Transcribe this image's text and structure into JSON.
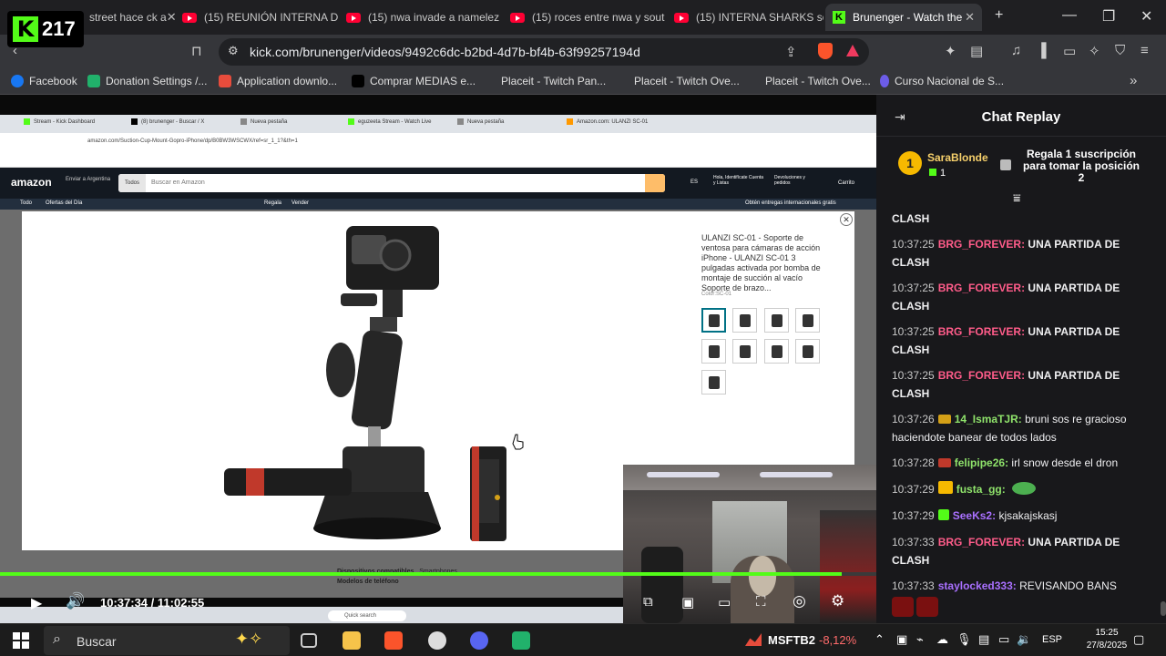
{
  "overlay": {
    "badge_count": "217"
  },
  "browser": {
    "tabs": [
      {
        "label": "street hace ck a",
        "icon": "partial-icon"
      },
      {
        "label": "(15) REUNIÓN INTERNA DI",
        "icon": "youtube-icon"
      },
      {
        "label": "(15) nwa invade a namelez",
        "icon": "youtube-icon"
      },
      {
        "label": "(15) roces entre nwa y sout",
        "icon": "youtube-icon"
      },
      {
        "label": "(15) INTERNA SHARKS sob",
        "icon": "youtube-icon"
      },
      {
        "label": "Brunenger - Watch the",
        "icon": "kick-icon",
        "active": true
      }
    ],
    "url": "kick.com/brunenger/videos/9492c6dc-b2bd-4d7b-bf4b-63f99257194d",
    "bookmarks": [
      {
        "label": "Facebook",
        "color": "#1877f2"
      },
      {
        "label": "Donation Settings /...",
        "color": "#21b16b"
      },
      {
        "label": "Application downlo...",
        "color": "#e74c3c"
      },
      {
        "label": "Comprar MEDIAS e...",
        "color": "#111111"
      },
      {
        "label": "Placeit - Twitch Pan...",
        "color": "#35363a"
      },
      {
        "label": "Placeit - Twitch Ove...",
        "color": "#35363a"
      },
      {
        "label": "Placeit - Twitch Ove...",
        "color": "#35363a"
      },
      {
        "label": "Curso Nacional de S...",
        "color": "#6c5ce7"
      }
    ]
  },
  "video": {
    "inner_tabs": [
      "Stream - Kick Dashboard",
      "(8) brunenger - Buscar / X",
      "Nueva pestaña",
      "eguzeeta Stream - Watch Live",
      "Nueva pestaña",
      "Amazon.com: ULANZI SC-01"
    ],
    "inner_url": "amazon.com/Suction-Cup-Mount-Gopro-iPhone/dp/B0BW3WSCWX/ref=sr_1_1?&th=1",
    "amazon": {
      "logo": "amazon",
      "deliver": "Enviar a Argentina",
      "search_category": "Todos",
      "search_placeholder": "Buscar en Amazon",
      "lang": "ES",
      "account": "Hola, Identifícate Cuenta y Listas",
      "orders": "Devoluciones y pedidos",
      "cart": "Carrito",
      "sub_nav": [
        "Todo",
        "Ofertas del Día",
        "Regala",
        "Vender"
      ],
      "ship_note": "Obtén entregas internacionales gratis",
      "product_title": "ULANZI SC-01 - Soporte de ventosa para cámaras de acción iPhone - ULANZI SC-01 3 pulgadas activada por bomba de montaje de succión al vacío Soporte de brazo...",
      "color_label": "Color:SC-01",
      "below": [
        "Dispositivos compatibles",
        "Smartphones",
        "Modelos de teléfono"
      ]
    },
    "inner_taskbar_search": "Quick search",
    "time_current": "10:37:34",
    "time_total": "11:02:55",
    "progress": 0.96
  },
  "chat": {
    "title": "Chat Replay",
    "pinned": {
      "rank": "1",
      "user": "SaraBlonde",
      "count": "1",
      "text": "Regala 1 suscripción para tomar la posición 2"
    },
    "messages": [
      {
        "time": "",
        "user": "",
        "user_color": "#efeff1",
        "text": "CLASH"
      },
      {
        "time": "10:37:25",
        "user": "BRG_FOREVER:",
        "user_color": "#ff5c8a",
        "text": "UNA PARTIDA DE CLASH"
      },
      {
        "time": "10:37:25",
        "user": "BRG_FOREVER:",
        "user_color": "#ff5c8a",
        "text": "UNA PARTIDA DE CLASH"
      },
      {
        "time": "10:37:25",
        "user": "BRG_FOREVER:",
        "user_color": "#ff5c8a",
        "text": "UNA PARTIDA DE CLASH"
      },
      {
        "time": "10:37:25",
        "user": "BRG_FOREVER:",
        "user_color": "#ff5c8a",
        "text": "UNA PARTIDA DE CLASH"
      },
      {
        "time": "10:37:26",
        "user": "14_IsmaTJR:",
        "user_color": "#8fe36b",
        "text": "bruni sos re gracioso haciendote banear de todos lados"
      },
      {
        "time": "10:37:28",
        "user": "felipipe26:",
        "user_color": "#8fe36b",
        "text": "irl snow desde el dron"
      },
      {
        "time": "10:37:29",
        "user": "fusta_gg:",
        "user_color": "#8fe36b",
        "text": ""
      },
      {
        "time": "10:37:29",
        "user": "SeeKs2:",
        "user_color": "#a970ff",
        "text": "kjsakajskasj"
      },
      {
        "time": "10:37:33",
        "user": "BRG_FOREVER:",
        "user_color": "#ff5c8a",
        "text": "UNA PARTIDA DE CLASH"
      },
      {
        "time": "10:37:33",
        "user": "staylocked333:",
        "user_color": "#a970ff",
        "text": "REVISANDO BANS"
      }
    ]
  },
  "taskbar": {
    "search_placeholder": "Buscar",
    "stock_symbol": "MSFTB2",
    "stock_change": "-8,12%",
    "lang": "ESP",
    "time": "15:25",
    "date": "27/8/2025"
  }
}
